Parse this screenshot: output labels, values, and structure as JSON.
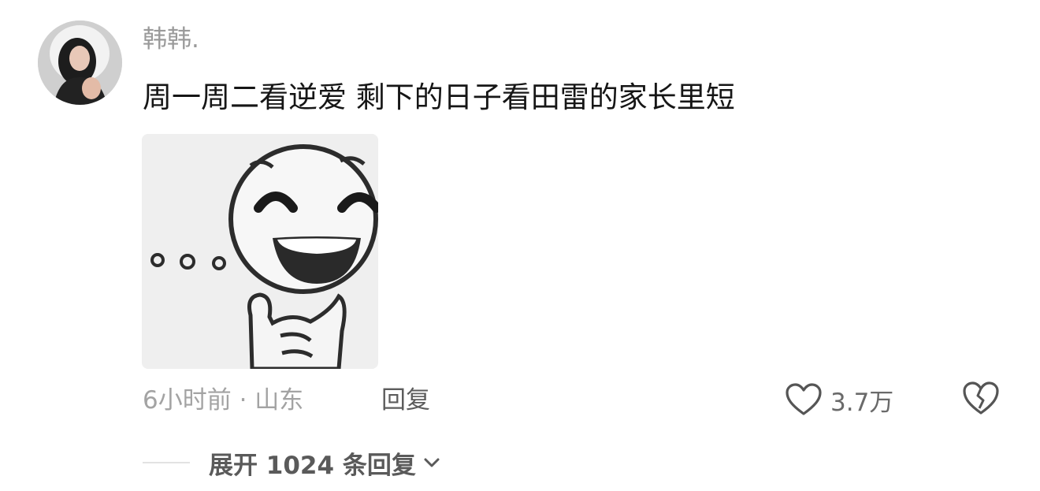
{
  "comment": {
    "username": "韩韩.",
    "text": "周一周二看逆爱 剩下的日子看田雷的家长里短",
    "meta": "6小时前 · 山东",
    "reply_label": "回复",
    "like_count": "3.7万",
    "expand_label": "展开 1024 条回复"
  },
  "icons": {
    "avatar": "user-avatar",
    "sticker": "smiley-thinking-sticker",
    "like": "heart-outline-icon",
    "dislike": "broken-heart-icon",
    "expand": "chevron-down-icon"
  },
  "colors": {
    "background": "#ffffff",
    "username": "#9a9a9a",
    "text": "#161616",
    "meta": "#a3a3a3",
    "secondary": "#5c5c5c"
  }
}
